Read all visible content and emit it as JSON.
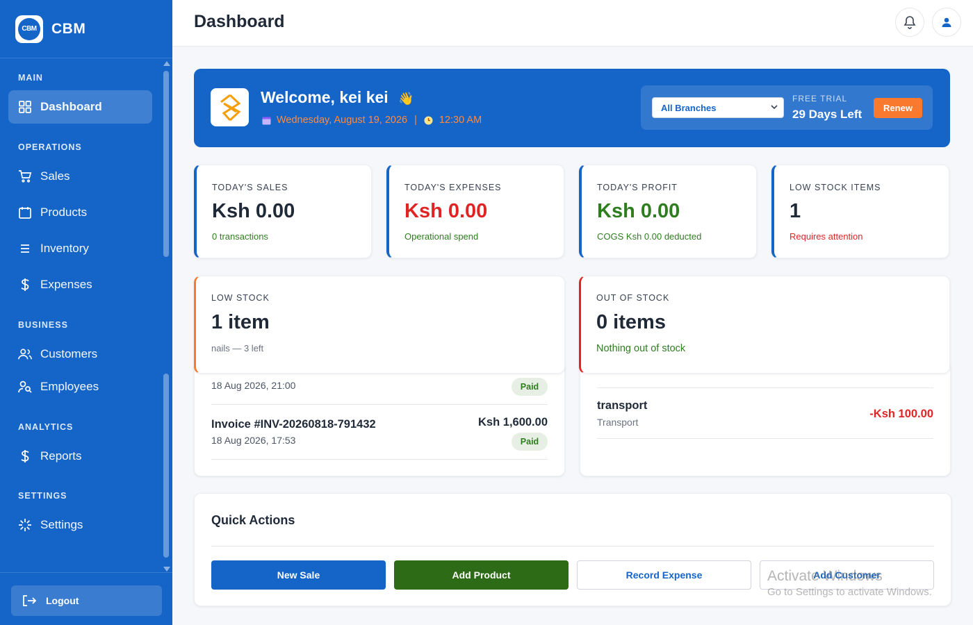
{
  "brand": {
    "logo_text": "CBM",
    "name": "CBM"
  },
  "sidebar": {
    "sections": [
      "MAIN",
      "OPERATIONS",
      "BUSINESS",
      "ANALYTICS",
      "SETTINGS"
    ],
    "items": [
      {
        "label": "Dashboard",
        "icon": "grid-icon",
        "active": true
      },
      {
        "label": "Sales",
        "icon": "cart-icon"
      },
      {
        "label": "Products",
        "icon": "calendar-icon"
      },
      {
        "label": "Inventory",
        "icon": "list-icon"
      },
      {
        "label": "Expenses",
        "icon": "dollar-icon"
      },
      {
        "label": "Customers",
        "icon": "users-icon"
      },
      {
        "label": "Employees",
        "icon": "user-search-icon"
      },
      {
        "label": "Reports",
        "icon": "dollar-icon"
      },
      {
        "label": "Settings",
        "icon": "settings-icon"
      }
    ],
    "logout_label": "Logout"
  },
  "header": {
    "title": "Dashboard"
  },
  "welcome": {
    "title": "Welcome, kei kei",
    "wave": "👋",
    "date": "Wednesday, August 19, 2026",
    "separator": "|",
    "time": "12:30 AM",
    "branch_selected": "All Branches",
    "trial_label": "FREE TRIAL",
    "trial_days": "29 Days Left",
    "renew_label": "Renew"
  },
  "stats": [
    {
      "label": "TODAY'S SALES",
      "value": "Ksh 0.00",
      "sub": "0 transactions",
      "color": "#1f2937",
      "sub_color": "#2e7d1f"
    },
    {
      "label": "TODAY'S EXPENSES",
      "value": "Ksh 0.00",
      "sub": "Operational spend",
      "color": "#e02424",
      "sub_color": "#2e7d1f"
    },
    {
      "label": "TODAY'S PROFIT",
      "value": "Ksh 0.00",
      "sub": "COGS Ksh 0.00 deducted",
      "color": "#2e7d1f",
      "sub_color": "#2e7d1f"
    },
    {
      "label": "LOW STOCK ITEMS",
      "value": "1",
      "sub": "Requires attention",
      "color": "#1f2937",
      "sub_color": "#e02424"
    }
  ],
  "low_stock": {
    "label": "LOW STOCK",
    "value": "1 item",
    "sub": "nails — 3 left"
  },
  "out_of_stock": {
    "label": "OUT OF STOCK",
    "value": "0 items",
    "sub": "Nothing out of stock"
  },
  "recent_sales": [
    {
      "date": "18 Aug 2026, 21:00",
      "status": "Paid"
    },
    {
      "invoice": "Invoice #INV-20260818-791432",
      "date": "18 Aug 2026, 17:53",
      "amount": "Ksh 1,600.00",
      "status": "Paid"
    }
  ],
  "recent_expenses": [
    {
      "name": "transport",
      "category": "Transport",
      "amount": "-Ksh 100.00"
    }
  ],
  "quick_actions": {
    "title": "Quick Actions",
    "buttons": [
      "New Sale",
      "Add Product",
      "Record Expense",
      "Add Customer"
    ]
  },
  "watermark": {
    "line1": "Activate Windows",
    "line2": "Go to Settings to activate Windows."
  },
  "colors": {
    "primary": "#1565c8",
    "green": "#2e7d1f",
    "red": "#e02424",
    "orange": "#f97a2f"
  }
}
